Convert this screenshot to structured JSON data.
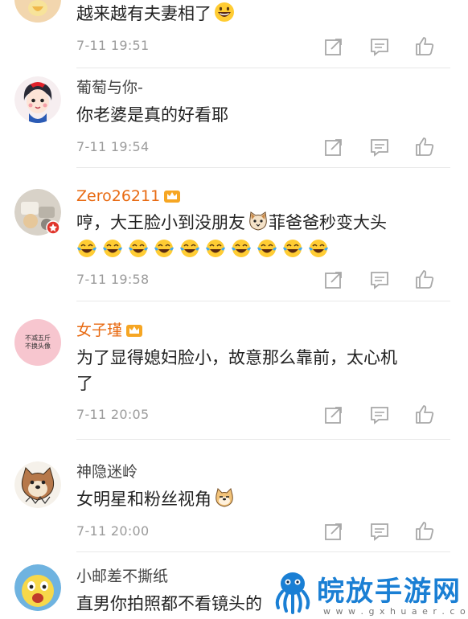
{
  "comments": [
    {
      "username": "",
      "text": "越来越有夫妻相了",
      "emoji": "grinning-emoji",
      "time": "7-11 19:51"
    },
    {
      "username": "葡萄与你-",
      "text": "你老婆是真的好看耶",
      "time": "7-11 19:54"
    },
    {
      "username": "Zero26211",
      "text_part1": "哼，大王脸小到没朋友",
      "text_part2": "菲爸爸秒变大头",
      "emoji": "cat-face-emoji",
      "tear_emoji_count": 10,
      "time": "7-11 19:58"
    },
    {
      "username": "女子瑾",
      "avatar_text_line1": "不减五斤",
      "avatar_text_line2": "不换头像",
      "text_line1": "为了显得媳妇脸小，故意那么靠前，太心机",
      "text_line2": "了",
      "time": "7-11 20:05"
    },
    {
      "username": "神隐迷岭",
      "text": "女明星和粉丝视角",
      "emoji": "doge-emoji",
      "time": "7-11 20:00"
    },
    {
      "username": "小邮差不撕纸",
      "text": "直男你拍照都不看镜头的"
    }
  ],
  "watermark": {
    "title": "皖放手游网",
    "url": "w w w . g x h u a e r . c o m"
  },
  "colors": {
    "username_orange": "#e86a12",
    "time_gray": "#9b9b9b",
    "icon_gray": "#a8a8a8",
    "watermark_blue": "#1a7fd4"
  }
}
